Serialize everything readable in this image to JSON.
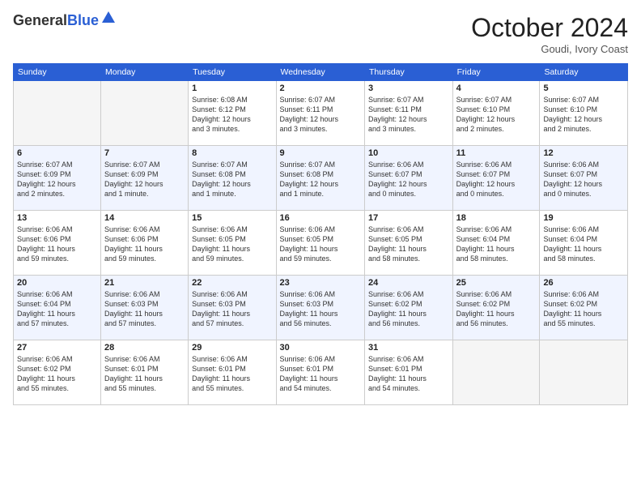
{
  "logo": {
    "general": "General",
    "blue": "Blue"
  },
  "header": {
    "month": "October 2024",
    "location": "Goudi, Ivory Coast"
  },
  "weekdays": [
    "Sunday",
    "Monday",
    "Tuesday",
    "Wednesday",
    "Thursday",
    "Friday",
    "Saturday"
  ],
  "weeks": [
    [
      {
        "day": "",
        "info": ""
      },
      {
        "day": "",
        "info": ""
      },
      {
        "day": "1",
        "info": "Sunrise: 6:08 AM\nSunset: 6:12 PM\nDaylight: 12 hours\nand 3 minutes."
      },
      {
        "day": "2",
        "info": "Sunrise: 6:07 AM\nSunset: 6:11 PM\nDaylight: 12 hours\nand 3 minutes."
      },
      {
        "day": "3",
        "info": "Sunrise: 6:07 AM\nSunset: 6:11 PM\nDaylight: 12 hours\nand 3 minutes."
      },
      {
        "day": "4",
        "info": "Sunrise: 6:07 AM\nSunset: 6:10 PM\nDaylight: 12 hours\nand 2 minutes."
      },
      {
        "day": "5",
        "info": "Sunrise: 6:07 AM\nSunset: 6:10 PM\nDaylight: 12 hours\nand 2 minutes."
      }
    ],
    [
      {
        "day": "6",
        "info": "Sunrise: 6:07 AM\nSunset: 6:09 PM\nDaylight: 12 hours\nand 2 minutes."
      },
      {
        "day": "7",
        "info": "Sunrise: 6:07 AM\nSunset: 6:09 PM\nDaylight: 12 hours\nand 1 minute."
      },
      {
        "day": "8",
        "info": "Sunrise: 6:07 AM\nSunset: 6:08 PM\nDaylight: 12 hours\nand 1 minute."
      },
      {
        "day": "9",
        "info": "Sunrise: 6:07 AM\nSunset: 6:08 PM\nDaylight: 12 hours\nand 1 minute."
      },
      {
        "day": "10",
        "info": "Sunrise: 6:06 AM\nSunset: 6:07 PM\nDaylight: 12 hours\nand 0 minutes."
      },
      {
        "day": "11",
        "info": "Sunrise: 6:06 AM\nSunset: 6:07 PM\nDaylight: 12 hours\nand 0 minutes."
      },
      {
        "day": "12",
        "info": "Sunrise: 6:06 AM\nSunset: 6:07 PM\nDaylight: 12 hours\nand 0 minutes."
      }
    ],
    [
      {
        "day": "13",
        "info": "Sunrise: 6:06 AM\nSunset: 6:06 PM\nDaylight: 11 hours\nand 59 minutes."
      },
      {
        "day": "14",
        "info": "Sunrise: 6:06 AM\nSunset: 6:06 PM\nDaylight: 11 hours\nand 59 minutes."
      },
      {
        "day": "15",
        "info": "Sunrise: 6:06 AM\nSunset: 6:05 PM\nDaylight: 11 hours\nand 59 minutes."
      },
      {
        "day": "16",
        "info": "Sunrise: 6:06 AM\nSunset: 6:05 PM\nDaylight: 11 hours\nand 59 minutes."
      },
      {
        "day": "17",
        "info": "Sunrise: 6:06 AM\nSunset: 6:05 PM\nDaylight: 11 hours\nand 58 minutes."
      },
      {
        "day": "18",
        "info": "Sunrise: 6:06 AM\nSunset: 6:04 PM\nDaylight: 11 hours\nand 58 minutes."
      },
      {
        "day": "19",
        "info": "Sunrise: 6:06 AM\nSunset: 6:04 PM\nDaylight: 11 hours\nand 58 minutes."
      }
    ],
    [
      {
        "day": "20",
        "info": "Sunrise: 6:06 AM\nSunset: 6:04 PM\nDaylight: 11 hours\nand 57 minutes."
      },
      {
        "day": "21",
        "info": "Sunrise: 6:06 AM\nSunset: 6:03 PM\nDaylight: 11 hours\nand 57 minutes."
      },
      {
        "day": "22",
        "info": "Sunrise: 6:06 AM\nSunset: 6:03 PM\nDaylight: 11 hours\nand 57 minutes."
      },
      {
        "day": "23",
        "info": "Sunrise: 6:06 AM\nSunset: 6:03 PM\nDaylight: 11 hours\nand 56 minutes."
      },
      {
        "day": "24",
        "info": "Sunrise: 6:06 AM\nSunset: 6:02 PM\nDaylight: 11 hours\nand 56 minutes."
      },
      {
        "day": "25",
        "info": "Sunrise: 6:06 AM\nSunset: 6:02 PM\nDaylight: 11 hours\nand 56 minutes."
      },
      {
        "day": "26",
        "info": "Sunrise: 6:06 AM\nSunset: 6:02 PM\nDaylight: 11 hours\nand 55 minutes."
      }
    ],
    [
      {
        "day": "27",
        "info": "Sunrise: 6:06 AM\nSunset: 6:02 PM\nDaylight: 11 hours\nand 55 minutes."
      },
      {
        "day": "28",
        "info": "Sunrise: 6:06 AM\nSunset: 6:01 PM\nDaylight: 11 hours\nand 55 minutes."
      },
      {
        "day": "29",
        "info": "Sunrise: 6:06 AM\nSunset: 6:01 PM\nDaylight: 11 hours\nand 55 minutes."
      },
      {
        "day": "30",
        "info": "Sunrise: 6:06 AM\nSunset: 6:01 PM\nDaylight: 11 hours\nand 54 minutes."
      },
      {
        "day": "31",
        "info": "Sunrise: 6:06 AM\nSunset: 6:01 PM\nDaylight: 11 hours\nand 54 minutes."
      },
      {
        "day": "",
        "info": ""
      },
      {
        "day": "",
        "info": ""
      }
    ]
  ]
}
